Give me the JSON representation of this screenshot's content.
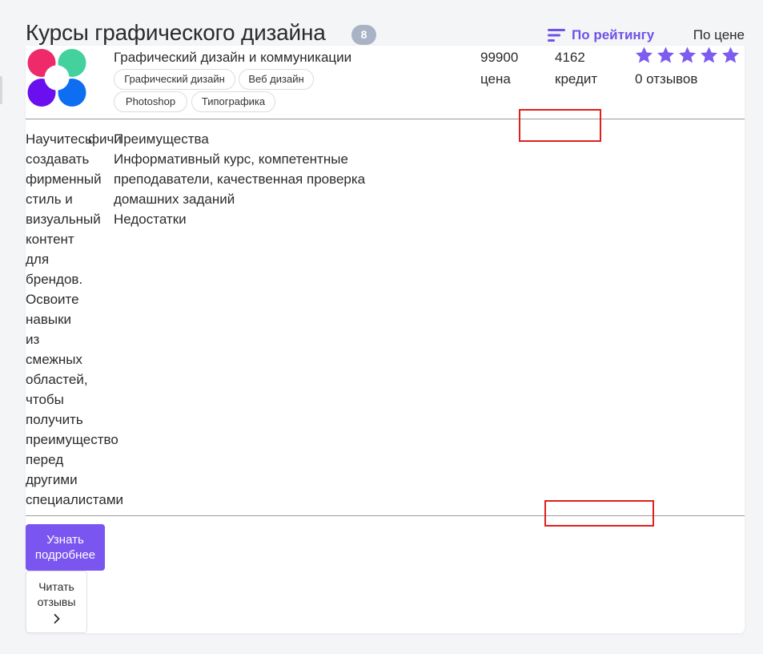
{
  "header": {
    "title": "Курсы графического дизайна",
    "count": "8",
    "sort_rating_label": "По рейтингу",
    "sort_price_label": "По цене",
    "accent_color": "#6f52e8"
  },
  "course": {
    "name": "Графический дизайн и коммуникации",
    "tags": [
      "Графический дизайн",
      "Веб дизайн",
      "Photoshop",
      "Типографика"
    ],
    "price_value": "99900",
    "price_label": "цена",
    "credit_value": "4162",
    "credit_label": "кредит",
    "rating": 5,
    "star_color": "#7d5cf0",
    "reviews_count": "0 отзывов",
    "description": "Научитесь\nсоздавать\nфирменный\nстиль и\nвизуальный\nконтент\nдля\nбрендов.\nОсвоите\nнавыки\nиз\nсмежных\nобластей,\nчтобы\nполучить\nпреимущество\nперед\nдругими\nспециалистами",
    "description_overlap": "фичи",
    "pros_title": "Преимущества",
    "pros_text": "Информативный курс, компетентные преподаватели, качественная проверка домашних заданий",
    "cons_title": "Недостатки",
    "more_button": "Узнать\nподробнее",
    "reviews_button": "Читать\nотзывы",
    "logo_colors": [
      "#ee2a6b",
      "#43d19e",
      "#6a0ff0",
      "#0e6ef2"
    ]
  }
}
